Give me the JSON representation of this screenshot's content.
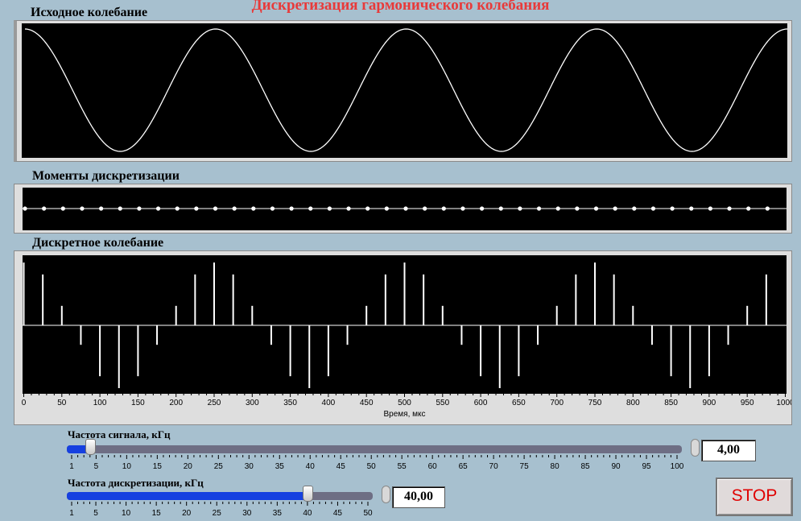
{
  "window_title": "Дискретизация гармонического колебания",
  "panels": {
    "original": {
      "label": "Исходное колебание"
    },
    "moments": {
      "label": "Моменты дискретизации"
    },
    "discrete": {
      "label": "Дискретное колебание",
      "xlabel": "Время, мкс",
      "xticks": [
        0,
        50,
        100,
        150,
        200,
        250,
        300,
        350,
        400,
        450,
        500,
        550,
        600,
        650,
        700,
        750,
        800,
        850,
        900,
        950,
        1000
      ]
    }
  },
  "controls": {
    "signal_freq": {
      "label": "Частота сигнала, кГц",
      "value_text": "4,00",
      "value": 4,
      "min": 1,
      "max": 100,
      "ticks": [
        1,
        5,
        10,
        15,
        20,
        25,
        30,
        35,
        40,
        45,
        50,
        55,
        60,
        65,
        70,
        75,
        80,
        85,
        90,
        95,
        100
      ]
    },
    "sampling_freq": {
      "label": "Частота дискретизации, кГц",
      "value_text": "40,00",
      "value": 40,
      "min": 1,
      "max": 50,
      "ticks": [
        1,
        5,
        10,
        15,
        20,
        25,
        30,
        35,
        40,
        45,
        50
      ]
    }
  },
  "stop_button": {
    "label": "STOP"
  },
  "colors": {
    "title": "#e83a3a",
    "slider_fill": "#1640e0",
    "stop_text": "#e00000",
    "background": "#a7c0cf"
  },
  "chart_data": [
    {
      "type": "line",
      "title": "Исходное колебание",
      "x_range": [
        0,
        1000
      ],
      "function": "cos",
      "frequency_khz": 4,
      "amplitude": 1,
      "note_x_unit": "мкс"
    },
    {
      "type": "scatter",
      "title": "Моменты дискретизации",
      "x_range": [
        0,
        1000
      ],
      "interval_us": 25
    },
    {
      "type": "bar",
      "title": "Дискретное колебание",
      "xlabel": "Время, мкс",
      "xlim": [
        0,
        1000
      ],
      "x": [
        0,
        25,
        50,
        75,
        100,
        125,
        150,
        175,
        200,
        225,
        250,
        275,
        300,
        325,
        350,
        375,
        400,
        425,
        450,
        475,
        500,
        525,
        550,
        575,
        600,
        625,
        650,
        675,
        700,
        725,
        750,
        775,
        800,
        825,
        850,
        875,
        900,
        925,
        950,
        975
      ],
      "values": [
        1,
        0.81,
        0.31,
        -0.31,
        -0.81,
        -1,
        -0.81,
        -0.31,
        0.31,
        0.81,
        1,
        0.81,
        0.31,
        -0.31,
        -0.81,
        -1,
        -0.81,
        -0.31,
        0.31,
        0.81,
        1,
        0.81,
        0.31,
        -0.31,
        -0.81,
        -1,
        -0.81,
        -0.31,
        0.31,
        0.81,
        1,
        0.81,
        0.31,
        -0.31,
        -0.81,
        -1,
        -0.81,
        -0.31,
        0.31,
        0.81
      ]
    }
  ]
}
